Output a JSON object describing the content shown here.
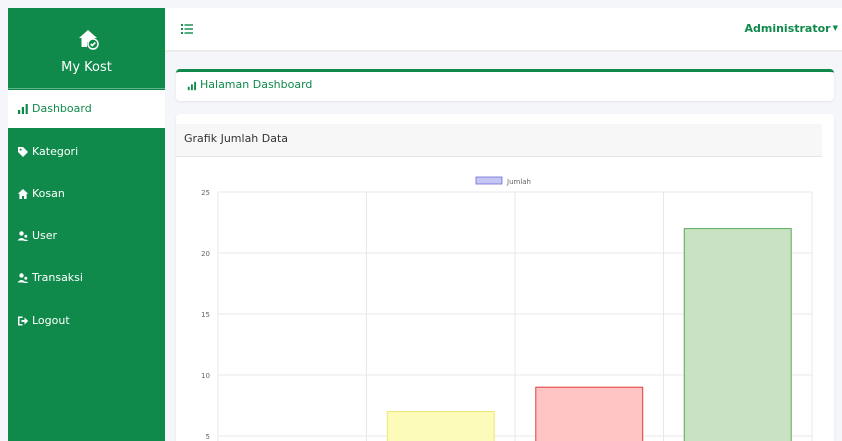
{
  "brand": {
    "name": "My Kost",
    "icon": "home-check-icon"
  },
  "sidebar": {
    "items": [
      {
        "label": "Dashboard",
        "icon": "bar-chart-icon",
        "active": true
      },
      {
        "label": "Kategori",
        "icon": "tag-icon",
        "active": false
      },
      {
        "label": "Kosan",
        "icon": "home-icon",
        "active": false
      },
      {
        "label": "User",
        "icon": "users-icon",
        "active": false
      },
      {
        "label": "Transaksi",
        "icon": "users-icon",
        "active": false
      },
      {
        "label": "Logout",
        "icon": "sign-out-icon",
        "active": false
      }
    ]
  },
  "topbar": {
    "menu_icon": "list-icon",
    "user": "Administrator"
  },
  "page": {
    "title": "Halaman Dashboard"
  },
  "card": {
    "title": "Grafik Jumlah Data"
  },
  "colors": {
    "primary": "#0f8a4b",
    "sidebar_text": "#ffffff",
    "legend_fill": "#c6c6f5",
    "legend_stroke": "#6b6bd6"
  },
  "chart_data": {
    "type": "bar",
    "categories": [
      "",
      "",
      "",
      ""
    ],
    "series": [
      {
        "name": "Jumlah",
        "values": [
          0,
          7,
          9,
          22
        ],
        "fills": [
          "#e0e0e0",
          "#fdfbb9",
          "#ffc4c4",
          "#c8e2c3"
        ],
        "strokes": [
          "#bbbbbb",
          "#ece671",
          "#e23b3b",
          "#5da85a"
        ]
      }
    ],
    "ylim": [
      0,
      25
    ],
    "yticks": [
      5,
      10,
      15,
      20,
      25
    ],
    "grid": true,
    "legend": "top-center",
    "title": "",
    "xlabel": "",
    "ylabel": ""
  }
}
